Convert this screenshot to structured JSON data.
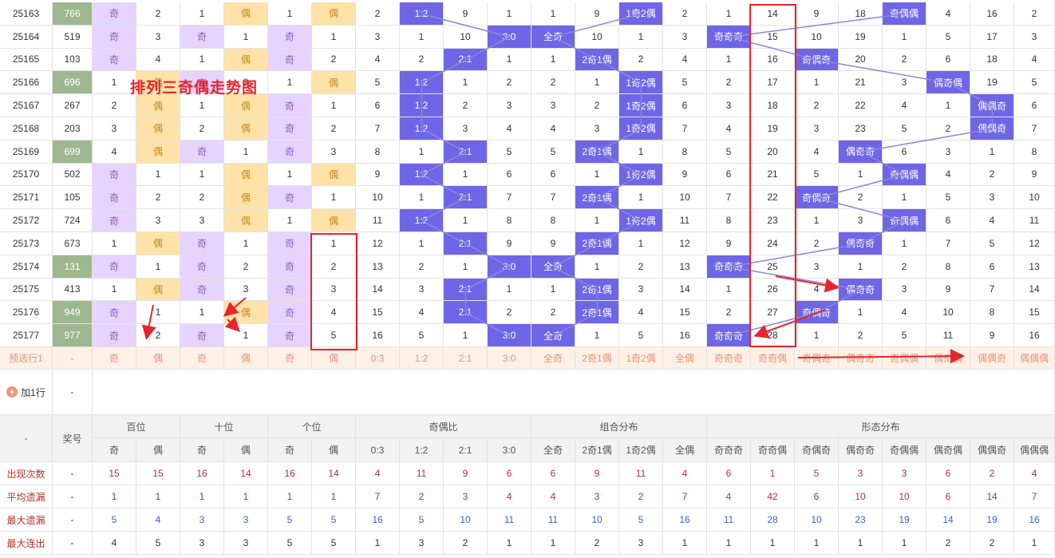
{
  "title": "排列三奇偶走势图",
  "rows": [
    {
      "issue": "25163",
      "num": "766",
      "green": true,
      "bai": [
        "奇",
        "2"
      ],
      "shi": [
        "1",
        "偶"
      ],
      "ge": [
        "1",
        "偶"
      ],
      "ratio": [
        "2",
        "1:2",
        "9",
        "1"
      ],
      "combo": [
        "1",
        "9",
        "1奇2偶",
        "2"
      ],
      "form": [
        "1",
        "14",
        "9",
        "18",
        "奇偶偶",
        "4",
        "16",
        "2"
      ]
    },
    {
      "issue": "25164",
      "num": "519",
      "green": false,
      "bai": [
        "奇",
        "3"
      ],
      "shi": [
        "奇",
        "1"
      ],
      "ge": [
        "奇",
        "1"
      ],
      "ratio": [
        "3",
        "1",
        "10",
        "3:0"
      ],
      "combo": [
        "全奇",
        "10",
        "1",
        "3"
      ],
      "form": [
        "奇奇奇",
        "15",
        "10",
        "19",
        "1",
        "5",
        "17",
        "3"
      ]
    },
    {
      "issue": "25165",
      "num": "103",
      "green": false,
      "bai": [
        "奇",
        "4"
      ],
      "shi": [
        "1",
        "偶"
      ],
      "ge": [
        "奇",
        "2"
      ],
      "ratio": [
        "4",
        "2",
        "2:1",
        "1"
      ],
      "combo": [
        "1",
        "2奇1偶",
        "2",
        "4"
      ],
      "form": [
        "1",
        "16",
        "奇偶奇",
        "20",
        "2",
        "6",
        "18",
        "4"
      ]
    },
    {
      "issue": "25166",
      "num": "696",
      "green": true,
      "bai": [
        "1",
        "偶"
      ],
      "shi": [
        "奇",
        "2"
      ],
      "ge": [
        "1",
        "偶"
      ],
      "ratio": [
        "5",
        "1:2",
        "1",
        "2"
      ],
      "combo": [
        "2",
        "1",
        "1奇2偶",
        "5"
      ],
      "form": [
        "2",
        "17",
        "1",
        "21",
        "3",
        "偶奇偶",
        "19",
        "5"
      ]
    },
    {
      "issue": "25167",
      "num": "267",
      "green": false,
      "bai": [
        "2",
        "偶"
      ],
      "shi": [
        "1",
        "偶"
      ],
      "ge": [
        "奇",
        "1"
      ],
      "ratio": [
        "6",
        "1:2",
        "2",
        "3"
      ],
      "combo": [
        "3",
        "2",
        "1奇2偶",
        "6"
      ],
      "form": [
        "3",
        "18",
        "2",
        "22",
        "4",
        "1",
        "偶偶奇",
        "6"
      ]
    },
    {
      "issue": "25168",
      "num": "203",
      "green": false,
      "bai": [
        "3",
        "偶"
      ],
      "shi": [
        "2",
        "偶"
      ],
      "ge": [
        "奇",
        "2"
      ],
      "ratio": [
        "7",
        "1:2",
        "3",
        "4"
      ],
      "combo": [
        "4",
        "3",
        "1奇2偶",
        "7"
      ],
      "form": [
        "4",
        "19",
        "3",
        "23",
        "5",
        "2",
        "偶偶奇",
        "7"
      ]
    },
    {
      "issue": "25169",
      "num": "699",
      "green": true,
      "bai": [
        "4",
        "偶"
      ],
      "shi": [
        "奇",
        "1"
      ],
      "ge": [
        "奇",
        "3"
      ],
      "ratio": [
        "8",
        "1",
        "2:1",
        "5"
      ],
      "combo": [
        "5",
        "2奇1偶",
        "1",
        "8"
      ],
      "form": [
        "5",
        "20",
        "4",
        "偶奇奇",
        "6",
        "3",
        "1",
        "8"
      ]
    },
    {
      "issue": "25170",
      "num": "502",
      "green": false,
      "bai": [
        "奇",
        "1"
      ],
      "shi": [
        "1",
        "偶"
      ],
      "ge": [
        "1",
        "偶"
      ],
      "ratio": [
        "9",
        "1:2",
        "1",
        "6"
      ],
      "combo": [
        "6",
        "1",
        "1奇2偶",
        "9"
      ],
      "form": [
        "6",
        "21",
        "5",
        "1",
        "奇偶偶",
        "4",
        "2",
        "9"
      ]
    },
    {
      "issue": "25171",
      "num": "105",
      "green": false,
      "bai": [
        "奇",
        "2"
      ],
      "shi": [
        "2",
        "偶"
      ],
      "ge": [
        "奇",
        "1"
      ],
      "ratio": [
        "10",
        "1",
        "2:1",
        "7"
      ],
      "combo": [
        "7",
        "2奇1偶",
        "1",
        "10"
      ],
      "form": [
        "7",
        "22",
        "奇偶奇",
        "2",
        "1",
        "5",
        "3",
        "10"
      ]
    },
    {
      "issue": "25172",
      "num": "724",
      "green": false,
      "bai": [
        "奇",
        "3"
      ],
      "shi": [
        "3",
        "偶"
      ],
      "ge": [
        "1",
        "偶"
      ],
      "ratio": [
        "11",
        "1:2",
        "1",
        "8"
      ],
      "combo": [
        "8",
        "1",
        "1奇2偶",
        "11"
      ],
      "form": [
        "8",
        "23",
        "1",
        "3",
        "奇偶偶",
        "6",
        "4",
        "11"
      ]
    },
    {
      "issue": "25173",
      "num": "673",
      "green": false,
      "bai": [
        "1",
        "偶"
      ],
      "shi": [
        "奇",
        "1"
      ],
      "ge": [
        "奇",
        "1"
      ],
      "ratio": [
        "12",
        "1",
        "2:1",
        "9"
      ],
      "combo": [
        "9",
        "2奇1偶",
        "1",
        "12"
      ],
      "form": [
        "9",
        "24",
        "2",
        "偶奇奇",
        "1",
        "7",
        "5",
        "12"
      ]
    },
    {
      "issue": "25174",
      "num": "131",
      "green": true,
      "bai": [
        "奇",
        "1"
      ],
      "shi": [
        "奇",
        "2"
      ],
      "ge": [
        "奇",
        "2"
      ],
      "ratio": [
        "13",
        "2",
        "1",
        "3:0"
      ],
      "combo": [
        "全奇",
        "1",
        "2",
        "13"
      ],
      "form": [
        "奇奇奇",
        "25",
        "3",
        "1",
        "2",
        "8",
        "6",
        "13"
      ]
    },
    {
      "issue": "25175",
      "num": "413",
      "green": false,
      "bai": [
        "1",
        "偶"
      ],
      "shi": [
        "奇",
        "3"
      ],
      "ge": [
        "奇",
        "3"
      ],
      "ratio": [
        "14",
        "3",
        "2:1",
        "1"
      ],
      "combo": [
        "1",
        "2奇1偶",
        "3",
        "14"
      ],
      "form": [
        "1",
        "26",
        "4",
        "偶奇奇",
        "3",
        "9",
        "7",
        "14"
      ]
    },
    {
      "issue": "25176",
      "num": "949",
      "green": true,
      "bai": [
        "奇",
        "1"
      ],
      "shi": [
        "1",
        "偶"
      ],
      "ge": [
        "奇",
        "4"
      ],
      "ratio": [
        "15",
        "4",
        "2:1",
        "2"
      ],
      "combo": [
        "2",
        "2奇1偶",
        "4",
        "15"
      ],
      "form": [
        "2",
        "27",
        "奇偶奇",
        "1",
        "4",
        "10",
        "8",
        "15"
      ]
    },
    {
      "issue": "25177",
      "num": "977",
      "green": true,
      "bai": [
        "奇",
        "2"
      ],
      "shi": [
        "奇",
        "1"
      ],
      "ge": [
        "奇",
        "5"
      ],
      "ratio": [
        "16",
        "5",
        "1",
        "3:0"
      ],
      "combo": [
        "全奇",
        "1",
        "5",
        "16"
      ],
      "form": [
        "奇奇奇",
        "28",
        "1",
        "2",
        "5",
        "11",
        "9",
        "16"
      ]
    }
  ],
  "preselect": {
    "label": "预选行1",
    "num": "-",
    "cells": [
      "奇",
      "偶",
      "奇",
      "偶",
      "奇",
      "偶",
      "0:3",
      "1:2",
      "2:1",
      "3:0",
      "全奇",
      "2奇1偶",
      "1奇2偶",
      "全偶",
      "奇奇奇",
      "奇奇偶",
      "奇偶奇",
      "偶奇奇",
      "奇偶偶",
      "偶奇偶",
      "偶偶奇",
      "偶偶偶"
    ]
  },
  "add_row": {
    "label": "加1行",
    "plus": "+",
    "num": "-"
  },
  "header": {
    "dash": "-",
    "prize": "奖号",
    "groups": [
      "百位",
      "十位",
      "个位",
      "奇偶比",
      "组合分布",
      "形态分布"
    ],
    "subs": [
      "奇",
      "偶",
      "奇",
      "偶",
      "奇",
      "偶",
      "0:3",
      "1:2",
      "2:1",
      "3:0",
      "全奇",
      "2奇1偶",
      "1奇2偶",
      "全偶",
      "奇奇奇",
      "奇奇偶",
      "奇偶奇",
      "偶奇奇",
      "奇偶偶",
      "偶奇偶",
      "偶偶奇",
      "偶偶偶"
    ]
  },
  "stats": [
    {
      "label": "出现次数",
      "dash": "-",
      "cls": "stat-red",
      "values": [
        "15",
        "15",
        "16",
        "14",
        "16",
        "14",
        "4",
        "11",
        "9",
        "6",
        "6",
        "9",
        "11",
        "4",
        "6",
        "1",
        "5",
        "3",
        "3",
        "6",
        "2",
        "4"
      ]
    },
    {
      "label": "平均遗漏",
      "dash": "-",
      "cls": "stat-red",
      "values": [
        "1",
        "1",
        "1",
        "1",
        "1",
        "1",
        "7",
        "2",
        "3",
        "4",
        "4",
        "3",
        "2",
        "7",
        "4",
        "42",
        "6",
        "10",
        "10",
        "6",
        "14",
        "7"
      ]
    },
    {
      "label": "最大遗漏",
      "dash": "-",
      "cls": "stat-blue",
      "values": [
        "5",
        "4",
        "3",
        "3",
        "5",
        "5",
        "16",
        "5",
        "10",
        "11",
        "11",
        "10",
        "5",
        "16",
        "11",
        "28",
        "10",
        "23",
        "19",
        "14",
        "19",
        "16"
      ]
    },
    {
      "label": "最大连出",
      "dash": "-",
      "cls": "stat-gray",
      "values": [
        "4",
        "5",
        "3",
        "3",
        "5",
        "5",
        "1",
        "3",
        "2",
        "1",
        "1",
        "2",
        "3",
        "1",
        "1",
        "1",
        "1",
        "1",
        "1",
        "2",
        "2",
        "1"
      ]
    }
  ],
  "colors": {
    "mark": "#6e66e6",
    "odd": "#e6d3ff",
    "even": "#ffe2a8",
    "green": "#9db88f",
    "annotation": "#e8242b",
    "line": "#8c86d9"
  }
}
